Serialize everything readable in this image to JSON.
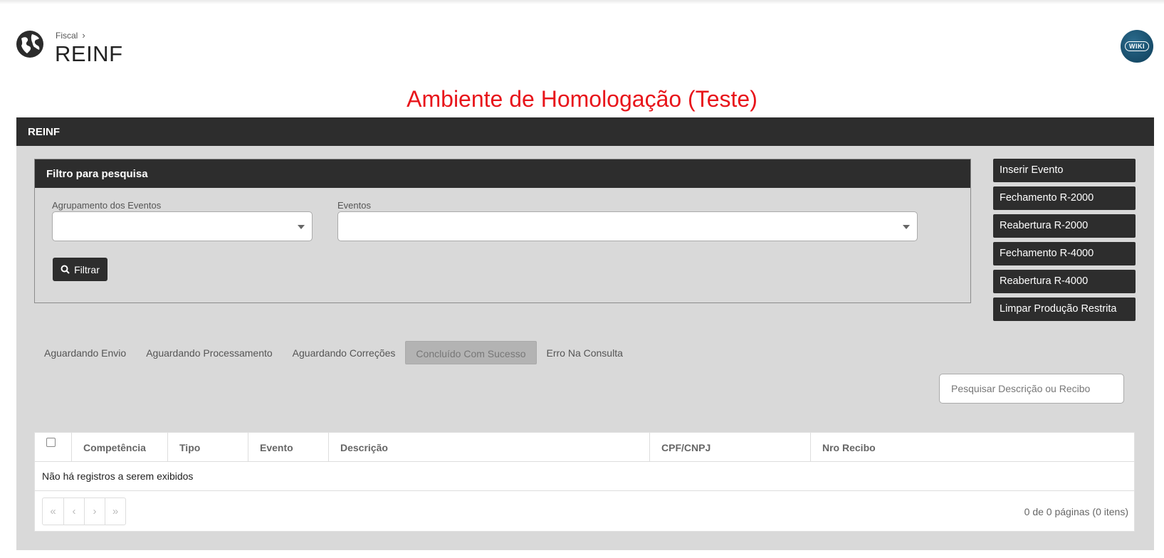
{
  "header": {
    "breadcrumb": "Fiscal",
    "title": "REINF",
    "wiki_label": "WIKI"
  },
  "environment_banner": "Ambiente de Homologação (Teste)",
  "colors": {
    "env_text": "#e8151b",
    "dark": "#2d2d2d",
    "panel_bg": "#d9d9d9",
    "wiki_bg": "#1a5473"
  },
  "panel": {
    "title": "REINF",
    "filter": {
      "title": "Filtro para pesquisa",
      "group_label": "Agrupamento dos Eventos",
      "group_value": "",
      "events_label": "Eventos",
      "events_value": "",
      "filter_button": "Filtrar"
    },
    "actions": [
      "Inserir Evento",
      "Fechamento R-2000",
      "Reabertura R-2000",
      "Fechamento R-4000",
      "Reabertura R-4000",
      "Limpar Produção Restrita"
    ],
    "tabs": [
      "Aguardando Envio",
      "Aguardando Processamento",
      "Aguardando Correções",
      "Concluído Com Sucesso",
      "Erro Na Consulta"
    ],
    "active_tab": "Concluído Com Sucesso",
    "search_placeholder": "Pesquisar Descrição ou Recibo",
    "table": {
      "columns": [
        "Competência",
        "Tipo",
        "Evento",
        "Descrição",
        "CPF/CNPJ",
        "Nro Recibo"
      ],
      "empty_message": "Não há registros a serem exibidos",
      "pager_info": "0 de 0 páginas (0 itens)"
    }
  }
}
